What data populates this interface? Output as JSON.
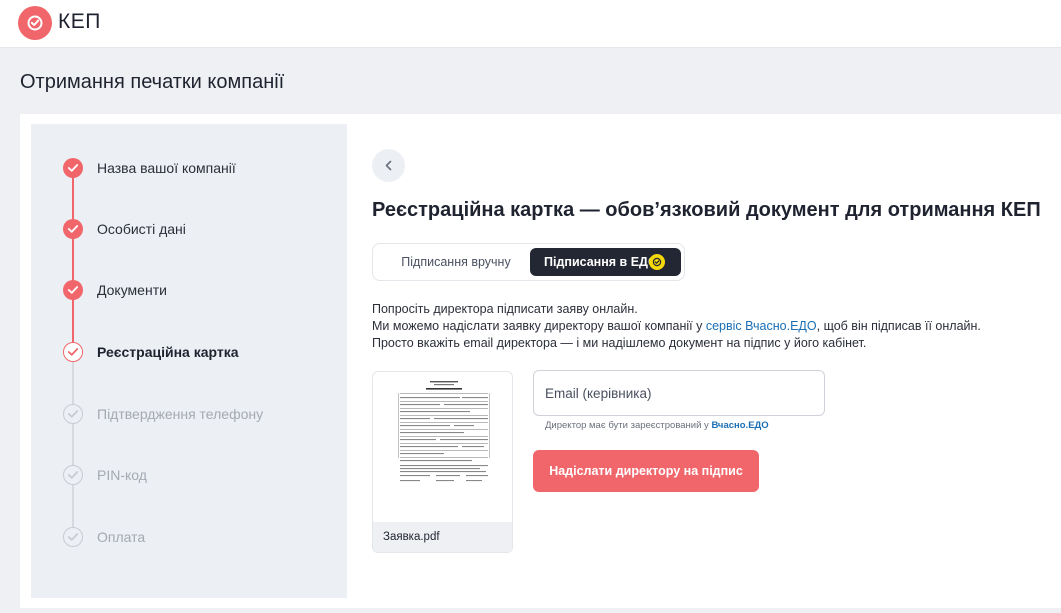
{
  "app": {
    "logo_text": "КЕП",
    "accent_color": "#f0666b"
  },
  "page": {
    "title": "Отримання печатки компанії"
  },
  "steps": [
    {
      "label": "Назва вашої компанії",
      "status": "done",
      "icon": "check-icon"
    },
    {
      "label": "Особисті дані",
      "status": "done",
      "icon": "check-icon"
    },
    {
      "label": "Документи",
      "status": "done",
      "icon": "check-icon"
    },
    {
      "label": "Реєстраційна картка",
      "status": "current",
      "icon": "check-icon"
    },
    {
      "label": "Підтвердження телефону",
      "status": "pending",
      "icon": "check-icon"
    },
    {
      "label": "PIN-код",
      "status": "pending",
      "icon": "check-icon"
    },
    {
      "label": "Оплата",
      "status": "pending",
      "icon": "check-icon"
    }
  ],
  "content": {
    "title": "Реєстраційна картка — обов’язковий документ для отримання КЕП",
    "toggle": {
      "manual_label": "Підписання вручну",
      "edo_label": "Підписання в ЕДО",
      "selected": "edo"
    },
    "description": {
      "line1": "Попросіть директора підписати заяву онлайн.",
      "line2_before": "Ми можемо надіслати заявку директору вашої компанії у ",
      "line2_link": "сервіс Вчасно.ЕДО",
      "line2_after": ", щоб він підписав її онлайн.",
      "line3": "Просто вкажіть email директора — і ми надішлемо документ на підпис у його кабінет."
    },
    "document": {
      "filename": "Заявка.pdf"
    },
    "email": {
      "placeholder": "Email (керівника)",
      "value": "",
      "hint_before": "Директор має бути зареєстрований у ",
      "hint_link": "Вчасно.ЕДО"
    },
    "send_button": "Надіслати директору на підпис"
  }
}
